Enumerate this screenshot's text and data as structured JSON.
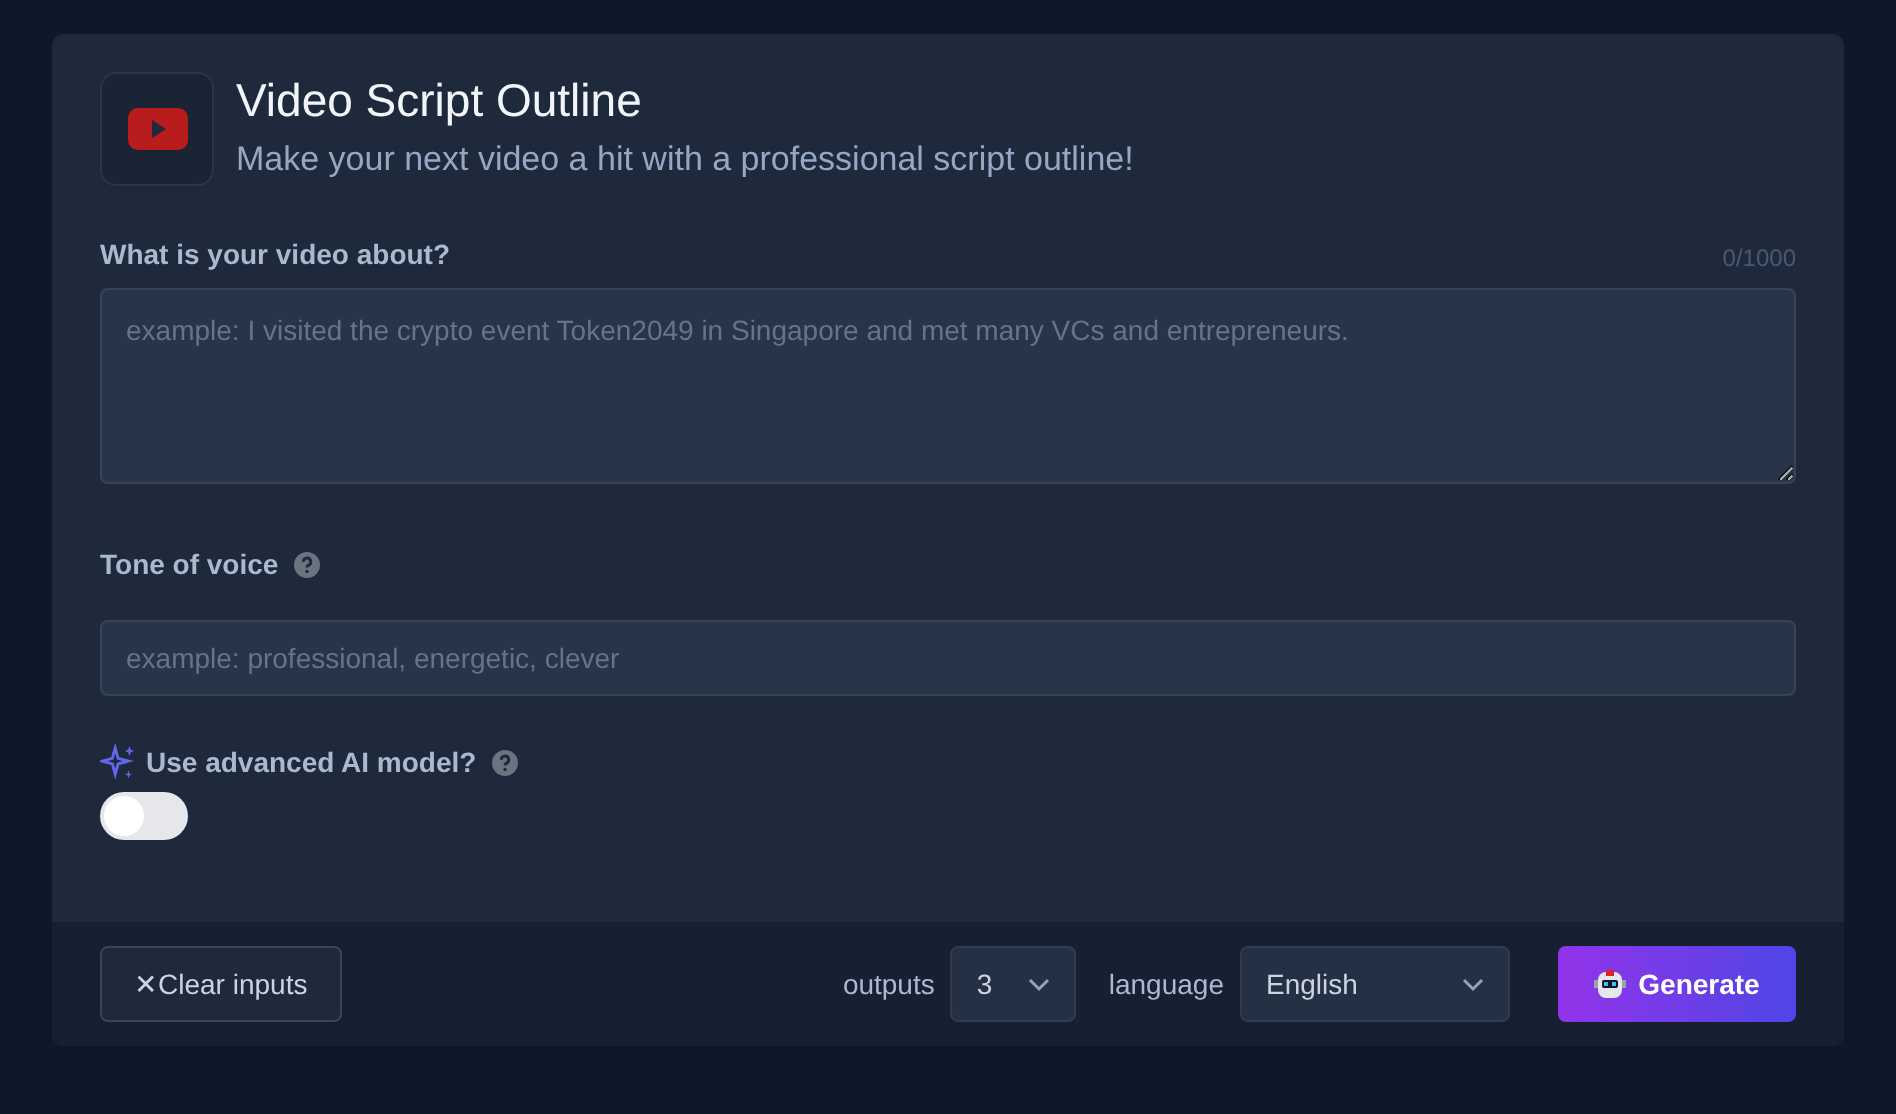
{
  "header": {
    "title": "Video Script Outline",
    "subtitle": "Make your next video a hit with a professional script outline!"
  },
  "topic": {
    "label": "What is your video about?",
    "counter": "0/1000",
    "placeholder": "example: I visited the crypto event Token2049 in Singapore and met many VCs and entrepreneurs."
  },
  "tone": {
    "label": "Tone of voice",
    "placeholder": "example: professional, energetic, clever"
  },
  "advanced": {
    "label": "Use advanced AI model?",
    "on": false
  },
  "footer": {
    "clear_button": "Clear inputs",
    "clear_icon": "✕",
    "outputs_label": "outputs",
    "outputs_value": "3",
    "language_label": "language",
    "language_value": "English",
    "generate_button": "Generate"
  }
}
